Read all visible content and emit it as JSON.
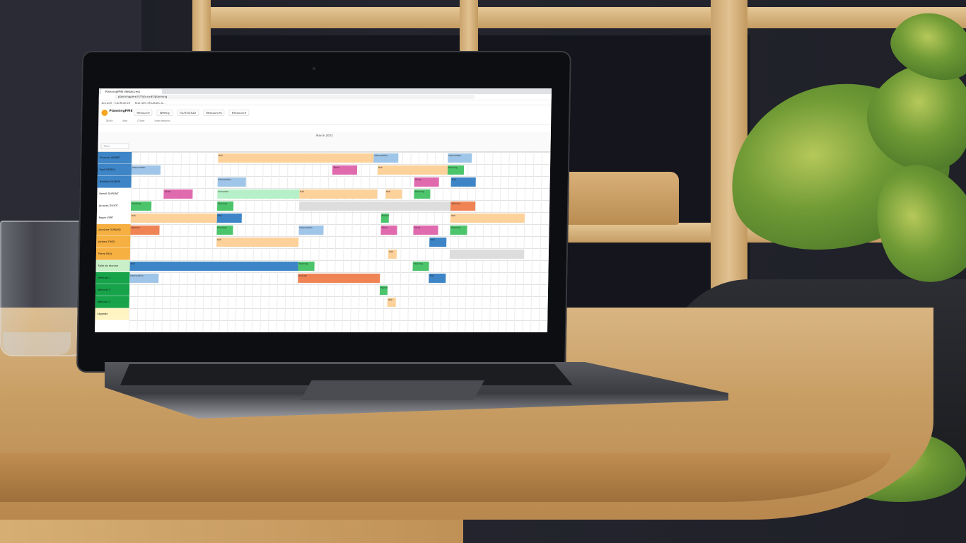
{
  "browser": {
    "tab_title": "PlanningPME WebAccess",
    "url": "planningpme.fr/?id=xx#!/planning",
    "bookmarks": [
      "Accueil - Confluence",
      "Tout des résultats w..."
    ]
  },
  "app": {
    "name": "PlanningPME",
    "toolbar": [
      "Resource",
      "Weekly",
      "01/03/2022",
      "Ressources",
      "Ressource"
    ],
    "submenu": [
      "Tâche",
      "Non",
      "Client",
      "Intervenants"
    ],
    "month_label": "March 2022",
    "filter_placeholder": "Filter"
  },
  "resources": [
    {
      "name": "François ANDRÉ",
      "color": "#3d85c6"
    },
    {
      "name": "Paul GARCIA",
      "color": "#3d85c6"
    },
    {
      "name": "Nathalie DUBOIS",
      "color": "#3d85c6"
    },
    {
      "name": "Benoît DUPONT",
      "color": "#ffffff"
    },
    {
      "name": "Jacques GUYOT",
      "color": "#ffffff"
    },
    {
      "name": "Roger VERT",
      "color": "#ffffff"
    },
    {
      "name": "Jocelyne DURAND",
      "color": "#f6b042"
    },
    {
      "name": "Jérôme THOS",
      "color": "#f6b042"
    },
    {
      "name": "Pierre PAUL",
      "color": "#f6b042"
    },
    {
      "name": "Salle de réunion",
      "color": "#c9f0c9"
    },
    {
      "name": "Véhicule 1",
      "color": "#16a34a"
    },
    {
      "name": "Véhicule 2",
      "color": "#16a34a"
    },
    {
      "name": "Véhicule 3",
      "color": "#16a34a"
    },
    {
      "name": "Légende",
      "color": "#fff5c2"
    }
  ],
  "colors": {
    "orange_light": "#fdd19a",
    "blue_light": "#9fc5e8",
    "blue": "#3d85c6",
    "pink": "#e06aae",
    "green": "#4cc46b",
    "mint": "#b6f0c8",
    "salmon": "#ef8354",
    "grey": "#dddddd"
  },
  "bars": [
    {
      "row": 0,
      "start": 10.5,
      "end": 29.5,
      "color": "orange_light",
      "label": "Bâti"
    },
    {
      "row": 0,
      "start": 29.5,
      "end": 32.5,
      "color": "blue_light",
      "label": "Intervention"
    },
    {
      "row": 0,
      "start": 38.5,
      "end": 41.5,
      "color": "blue_light",
      "label": "Intervention"
    },
    {
      "row": 1,
      "start": 0,
      "end": 3.5,
      "color": "blue_light",
      "label": "Intervention"
    },
    {
      "row": 1,
      "start": 24.5,
      "end": 27.5,
      "color": "pink",
      "label": "Tâche"
    },
    {
      "row": 1,
      "start": 30,
      "end": 38.5,
      "color": "orange_light",
      "label": "Bâti"
    },
    {
      "row": 1,
      "start": 38.5,
      "end": 40.5,
      "color": "green",
      "label": "Planning"
    },
    {
      "row": 2,
      "start": 10.5,
      "end": 14,
      "color": "blue_light",
      "label": "Intervention"
    },
    {
      "row": 2,
      "start": 34.5,
      "end": 37.5,
      "color": "pink",
      "label": "Tâche"
    },
    {
      "row": 2,
      "start": 39,
      "end": 42,
      "color": "blue",
      "label": "Bâti"
    },
    {
      "row": 3,
      "start": 4,
      "end": 7.5,
      "color": "pink",
      "label": "Tâche"
    },
    {
      "row": 3,
      "start": 10.5,
      "end": 20.5,
      "color": "mint",
      "label": "Formation"
    },
    {
      "row": 3,
      "start": 20.5,
      "end": 30,
      "color": "orange_light",
      "label": "Bâti"
    },
    {
      "row": 3,
      "start": 31,
      "end": 33,
      "color": "orange_light",
      "label": "Bâti"
    },
    {
      "row": 3,
      "start": 34.5,
      "end": 36.5,
      "color": "green",
      "label": "Planning"
    },
    {
      "row": 4,
      "start": 0,
      "end": 2.5,
      "color": "green",
      "label": "Planning"
    },
    {
      "row": 4,
      "start": 10.5,
      "end": 12.5,
      "color": "green",
      "label": "Planning"
    },
    {
      "row": 4,
      "start": 20.5,
      "end": 39,
      "color": "grey",
      "label": ""
    },
    {
      "row": 4,
      "start": 39,
      "end": 42,
      "color": "salmon",
      "label": "Réunion"
    },
    {
      "row": 5,
      "start": 0,
      "end": 10.5,
      "color": "orange_light",
      "label": "Bâti"
    },
    {
      "row": 5,
      "start": 10.5,
      "end": 13.5,
      "color": "blue",
      "label": "Bâti"
    },
    {
      "row": 5,
      "start": 30.5,
      "end": 31.5,
      "color": "green",
      "label": "Planning"
    },
    {
      "row": 5,
      "start": 39,
      "end": 48,
      "color": "orange_light",
      "label": "Bâti"
    },
    {
      "row": 6,
      "start": 0,
      "end": 3.5,
      "color": "salmon",
      "label": "Réunion"
    },
    {
      "row": 6,
      "start": 10.5,
      "end": 12.5,
      "color": "green",
      "label": "Planning"
    },
    {
      "row": 6,
      "start": 20.5,
      "end": 23.5,
      "color": "blue_light",
      "label": "Intervention"
    },
    {
      "row": 6,
      "start": 30.5,
      "end": 32.5,
      "color": "pink",
      "label": "Tâche"
    },
    {
      "row": 6,
      "start": 34.5,
      "end": 37.5,
      "color": "pink",
      "label": "Tâche"
    },
    {
      "row": 6,
      "start": 39,
      "end": 41,
      "color": "green",
      "label": "Planning"
    },
    {
      "row": 7,
      "start": 10.5,
      "end": 20.5,
      "color": "orange_light",
      "label": "Bâti"
    },
    {
      "row": 7,
      "start": 36.5,
      "end": 38.5,
      "color": "blue",
      "label": "Bâti"
    },
    {
      "row": 8,
      "start": 31.5,
      "end": 32.5,
      "color": "orange_light",
      "label": "Bâti"
    },
    {
      "row": 8,
      "start": 39,
      "end": 48,
      "color": "grey",
      "label": ""
    },
    {
      "row": 9,
      "start": 0,
      "end": 20.5,
      "color": "blue",
      "label": "Bâti"
    },
    {
      "row": 9,
      "start": 20.5,
      "end": 22.5,
      "color": "green",
      "label": "Planning"
    },
    {
      "row": 9,
      "start": 34.5,
      "end": 36.5,
      "color": "green",
      "label": "Planning"
    },
    {
      "row": 10,
      "start": 0,
      "end": 3.5,
      "color": "blue_light",
      "label": "Intervention"
    },
    {
      "row": 10,
      "start": 20.5,
      "end": 30.5,
      "color": "salmon",
      "label": "Réunion"
    },
    {
      "row": 10,
      "start": 36.5,
      "end": 38.5,
      "color": "blue",
      "label": "Bâti"
    },
    {
      "row": 11,
      "start": 30.5,
      "end": 31.5,
      "color": "green",
      "label": "Planning"
    },
    {
      "row": 12,
      "start": 31.5,
      "end": 32.5,
      "color": "orange_light",
      "label": "Bâti"
    }
  ]
}
